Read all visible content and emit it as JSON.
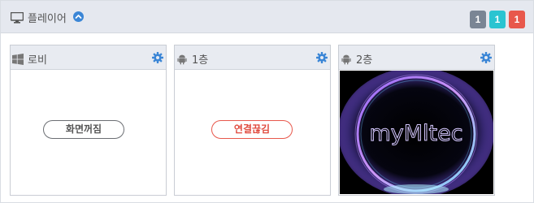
{
  "header": {
    "title": "플레이어",
    "monitor_icon": "monitor-icon",
    "chevron_icon": "chevron-up-circle-icon",
    "badges": [
      {
        "value": "1",
        "color": "#7a8594"
      },
      {
        "value": "1",
        "color": "#2bc4d1"
      },
      {
        "value": "1",
        "color": "#e8584c"
      }
    ]
  },
  "players": [
    {
      "name": "로비",
      "os_icon": "windows-icon",
      "gear_icon": "gear-icon",
      "status_label": "화면꺼짐"
    },
    {
      "name": "1층",
      "os_icon": "android-icon",
      "gear_icon": "gear-icon",
      "status_label": "연결끊김"
    },
    {
      "name": "2층",
      "os_icon": "android-icon",
      "gear_icon": "gear-icon",
      "preview_text": "myMltec"
    }
  ],
  "colors": {
    "accent_blue": "#3b86d6",
    "danger_red": "#e8584c"
  }
}
